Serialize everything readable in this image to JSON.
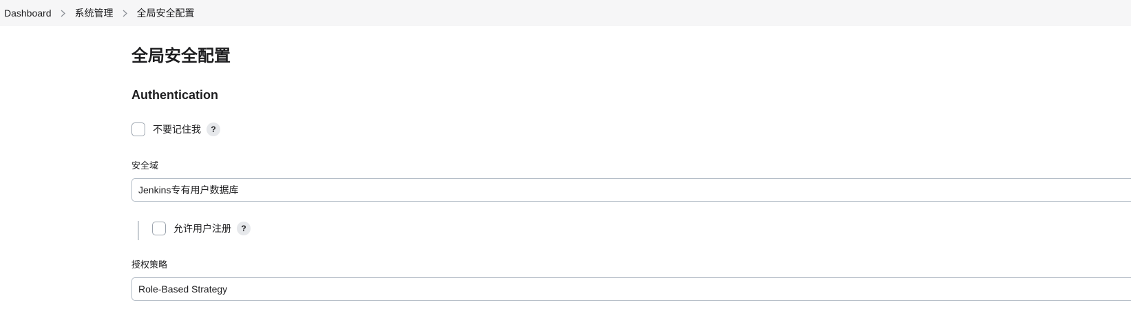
{
  "breadcrumb": {
    "items": [
      "Dashboard",
      "系统管理",
      "全局安全配置"
    ]
  },
  "page": {
    "title": "全局安全配置"
  },
  "authentication": {
    "section_title": "Authentication",
    "remember_me_label": "不要记住我",
    "remember_me_checked": false,
    "security_realm_label": "安全域",
    "security_realm_value": "Jenkins专有用户数据库",
    "allow_signup_label": "允许用户注册",
    "allow_signup_checked": false,
    "authorization_label": "授权策略",
    "authorization_value": "Role-Based Strategy"
  },
  "help_glyph": "?",
  "icons": {
    "separator": "chevron-right-icon",
    "help": "help-icon"
  },
  "colors": {
    "breadcrumb_bg": "#f6f6f7",
    "text": "#1d1d1f",
    "border": "#b3bcc6"
  }
}
